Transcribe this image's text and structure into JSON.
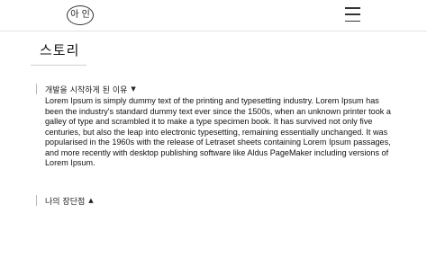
{
  "header": {
    "logo_text": "아 인",
    "menu_icon": "hamburger-menu-icon"
  },
  "page": {
    "title": "스토리"
  },
  "sections": [
    {
      "heading": "개발을 시작하게 된 이유",
      "caret": "▼",
      "body": "Lorem Ipsum is simply dummy text of the printing and typesetting industry. Lorem Ipsum has been the industry's standard dummy text ever since the 1500s, when an unknown printer took a galley of type and scrambled it to make a type specimen book. It has survived not only five centuries, but also the leap into electronic typesetting, remaining essentially unchanged. It was popularised in the 1960s with the release of Letraset sheets containing Lorem Ipsum passages, and more recently with desktop publishing software like Aldus PageMaker including versions of Lorem Ipsum."
    },
    {
      "heading": "나의 장단점",
      "caret": "▲"
    }
  ]
}
